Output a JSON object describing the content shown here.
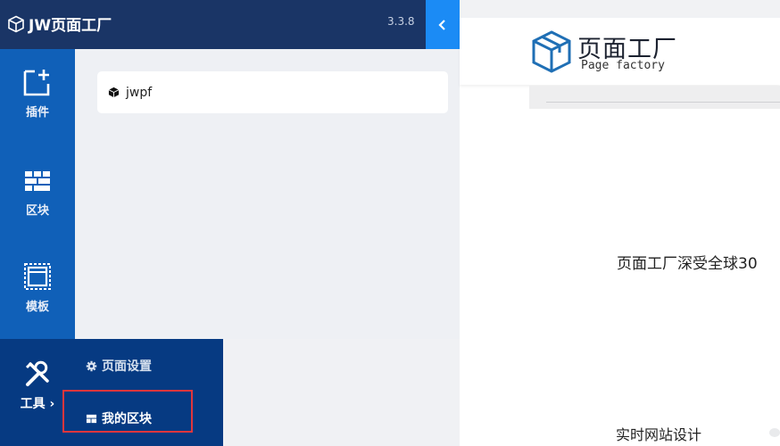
{
  "header": {
    "app_name": "JW页面工厂",
    "version": "3.3.8"
  },
  "rail": {
    "items": [
      {
        "label": "插件",
        "icon": "add-plugin-icon"
      },
      {
        "label": "区块",
        "icon": "blocks-icon"
      },
      {
        "label": "模板",
        "icon": "template-icon"
      }
    ],
    "tools": {
      "label": "工具",
      "icon": "tools-icon"
    }
  },
  "tools_menu": {
    "page_settings": "页面设置",
    "my_blocks": "我的区块"
  },
  "panel": {
    "plugin_name": "jwpf"
  },
  "preview": {
    "logo_cn": "页面工厂",
    "logo_en": "Page factory",
    "slogan": "页面工厂深受全球30",
    "footer": "实时网站设计"
  },
  "colors": {
    "header_bg": "#1a3566",
    "rail_bg": "#1060b8",
    "tools_bg": "#063a82",
    "accent": "#1b8bf5",
    "highlight": "#e0363c"
  }
}
